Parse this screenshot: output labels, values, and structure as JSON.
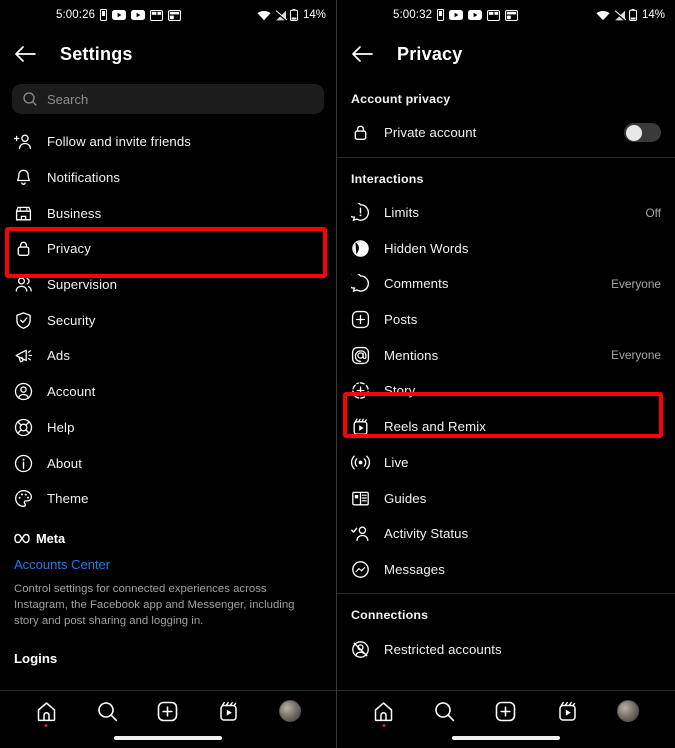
{
  "statusbar": {
    "left_time": "5:00:26",
    "right_time": "5:00:32",
    "battery": "14%",
    "icons": [
      "sim-icon",
      "youtube-icon",
      "youtube-icon",
      "picture-in-picture-icon",
      "split-screen-icon"
    ],
    "right_icons": [
      "wifi-icon",
      "cellular-signal-icon",
      "battery-icon"
    ]
  },
  "left_screen": {
    "header": {
      "title": "Settings",
      "back_icon": "back-arrow-icon"
    },
    "search": {
      "placeholder": "Search",
      "icon": "search-icon"
    },
    "items": [
      {
        "label": "Follow and invite friends",
        "icon": "add-person-icon"
      },
      {
        "label": "Notifications",
        "icon": "bell-icon"
      },
      {
        "label": "Business",
        "icon": "storefront-icon"
      },
      {
        "label": "Privacy",
        "icon": "lock-icon",
        "highlighted": true
      },
      {
        "label": "Supervision",
        "icon": "people-icon"
      },
      {
        "label": "Security",
        "icon": "shield-check-icon"
      },
      {
        "label": "Ads",
        "icon": "megaphone-icon"
      },
      {
        "label": "Account",
        "icon": "person-circle-icon"
      },
      {
        "label": "Help",
        "icon": "lifebuoy-icon"
      },
      {
        "label": "About",
        "icon": "info-circle-icon"
      },
      {
        "label": "Theme",
        "icon": "palette-icon"
      }
    ],
    "meta": {
      "brand": "Meta",
      "brand_icon": "meta-infinity-icon",
      "accounts_center_link": "Accounts Center",
      "description": "Control settings for connected experiences across Instagram, the Facebook app and Messenger, including story and post sharing and logging in."
    },
    "logins_heading": "Logins"
  },
  "right_screen": {
    "header": {
      "title": "Privacy",
      "back_icon": "back-arrow-icon"
    },
    "sections": [
      {
        "heading": "Account privacy",
        "items": [
          {
            "label": "Private account",
            "icon": "lock-icon",
            "control": "toggle",
            "toggle_on": false
          }
        ]
      },
      {
        "heading": "Interactions",
        "items": [
          {
            "label": "Limits",
            "icon": "exclamation-bubble-icon",
            "value": "Off"
          },
          {
            "label": "Hidden Words",
            "icon": "hidden-eye-icon",
            "value": ""
          },
          {
            "label": "Comments",
            "icon": "comment-bubble-icon",
            "value": "Everyone"
          },
          {
            "label": "Posts",
            "icon": "plus-square-icon",
            "value": ""
          },
          {
            "label": "Mentions",
            "icon": "at-square-icon",
            "value": "Everyone"
          },
          {
            "label": "Story",
            "icon": "story-plus-circle-icon",
            "value": "",
            "highlighted": true
          },
          {
            "label": "Reels and Remix",
            "icon": "reels-icon",
            "value": ""
          },
          {
            "label": "Live",
            "icon": "live-broadcast-icon",
            "value": ""
          },
          {
            "label": "Guides",
            "icon": "guides-book-icon",
            "value": ""
          },
          {
            "label": "Activity Status",
            "icon": "activity-status-icon",
            "value": ""
          },
          {
            "label": "Messages",
            "icon": "messenger-icon",
            "value": ""
          }
        ]
      },
      {
        "heading": "Connections",
        "items": [
          {
            "label": "Restricted accounts",
            "icon": "restricted-person-icon",
            "value": ""
          }
        ]
      }
    ]
  },
  "bottom_nav": {
    "items": [
      {
        "name": "home",
        "icon": "home-icon",
        "active": true
      },
      {
        "name": "search",
        "icon": "search-icon",
        "active": false
      },
      {
        "name": "create",
        "icon": "plus-square-icon",
        "active": false
      },
      {
        "name": "reels",
        "icon": "reels-icon",
        "active": false
      },
      {
        "name": "profile",
        "icon": "avatar-icon",
        "active": false
      }
    ]
  },
  "colors": {
    "highlight": "#fb0007",
    "link": "#1d7ced",
    "background": "#000000",
    "text": "#f2f2f2",
    "muted": "#a8a8a8"
  }
}
